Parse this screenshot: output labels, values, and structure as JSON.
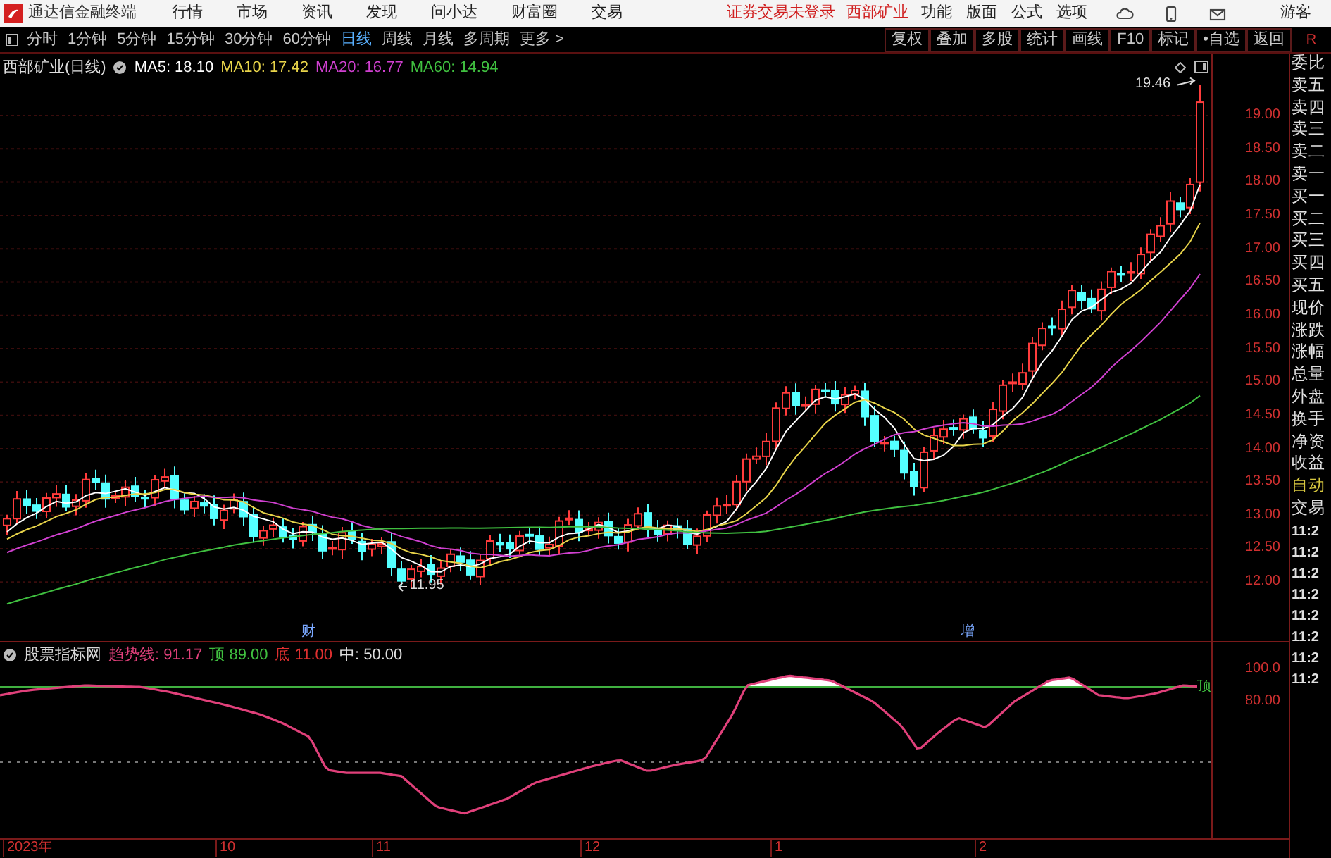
{
  "app": {
    "title": "通达信金融终端"
  },
  "menu": [
    "行情",
    "市场",
    "资讯",
    "发现",
    "问小达",
    "财富圈",
    "交易"
  ],
  "notices": [
    "证券交易未登录",
    "西部矿业"
  ],
  "top_actions": [
    "功能",
    "版面",
    "公式",
    "选项"
  ],
  "user": "游客",
  "period_tabs": [
    {
      "label": "分时",
      "selected": false
    },
    {
      "label": "1分钟",
      "selected": false
    },
    {
      "label": "5分钟",
      "selected": false
    },
    {
      "label": "15分钟",
      "selected": false
    },
    {
      "label": "30分钟",
      "selected": false
    },
    {
      "label": "60分钟",
      "selected": false
    },
    {
      "label": "日线",
      "selected": true
    },
    {
      "label": "周线",
      "selected": false
    },
    {
      "label": "月线",
      "selected": false
    },
    {
      "label": "多周期",
      "selected": false
    },
    {
      "label": "更多 >",
      "selected": false
    }
  ],
  "tool_buttons": [
    "复权",
    "叠加",
    "多股",
    "统计",
    "画线",
    "F10",
    "标记",
    "•自选",
    "返回"
  ],
  "corner_mark": "R",
  "chart": {
    "title": "西部矿业(日线)",
    "ma": [
      {
        "label": "MA5: 18.10",
        "color": "#ffffff"
      },
      {
        "label": "MA10: 17.42",
        "color": "#e8d44a"
      },
      {
        "label": "MA20: 16.77",
        "color": "#d040d0"
      },
      {
        "label": "MA60: 14.94",
        "color": "#40c040"
      }
    ],
    "high_label": "19.46",
    "low_label": "11.95",
    "events": [
      {
        "text": "财"
      },
      {
        "text": "增"
      }
    ],
    "price_axis": [
      "19.00",
      "18.50",
      "18.00",
      "17.50",
      "17.00",
      "16.50",
      "16.00",
      "15.50",
      "15.00",
      "14.50",
      "14.00",
      "13.50",
      "13.00",
      "12.50",
      "12.00"
    ]
  },
  "indicator": {
    "title": "股票指标网",
    "values": [
      {
        "text": "趋势线: 91.17",
        "color": "#e0407a"
      },
      {
        "text": "顶 89.00",
        "color": "#40c040"
      },
      {
        "text": "底 11.00",
        "color": "#e03030"
      },
      {
        "text": "中: 50.00",
        "color": "#e0e0e0"
      }
    ],
    "end_label": "顶",
    "axis": [
      "100.0",
      "80.00"
    ]
  },
  "date_axis": [
    "2023年",
    "10",
    "11",
    "12",
    "1",
    "2"
  ],
  "quote_panel": {
    "fields": [
      {
        "label": "委比",
        "kind": "field"
      },
      {
        "label": "卖五",
        "kind": "field"
      },
      {
        "label": "卖四",
        "kind": "field"
      },
      {
        "label": "卖三",
        "kind": "field"
      },
      {
        "label": "卖二",
        "kind": "field"
      },
      {
        "label": "卖一",
        "kind": "field"
      },
      {
        "label": "买一",
        "kind": "field"
      },
      {
        "label": "买二",
        "kind": "field"
      },
      {
        "label": "买三",
        "kind": "field"
      },
      {
        "label": "买四",
        "kind": "field"
      },
      {
        "label": "买五",
        "kind": "field"
      },
      {
        "label": "现价",
        "kind": "field"
      },
      {
        "label": "涨跌",
        "kind": "field"
      },
      {
        "label": "涨幅",
        "kind": "field"
      },
      {
        "label": "总量",
        "kind": "field"
      },
      {
        "label": "外盘",
        "kind": "field"
      },
      {
        "label": "换手",
        "kind": "field"
      },
      {
        "label": "净资",
        "kind": "field"
      },
      {
        "label": "收益",
        "kind": "field"
      },
      {
        "label": "自动",
        "kind": "action"
      },
      {
        "label": "交易",
        "kind": "field"
      }
    ],
    "times": [
      "11:2",
      "11:2",
      "11:2",
      "11:2",
      "11:2",
      "11:2",
      "11:2",
      "11:2"
    ]
  }
}
